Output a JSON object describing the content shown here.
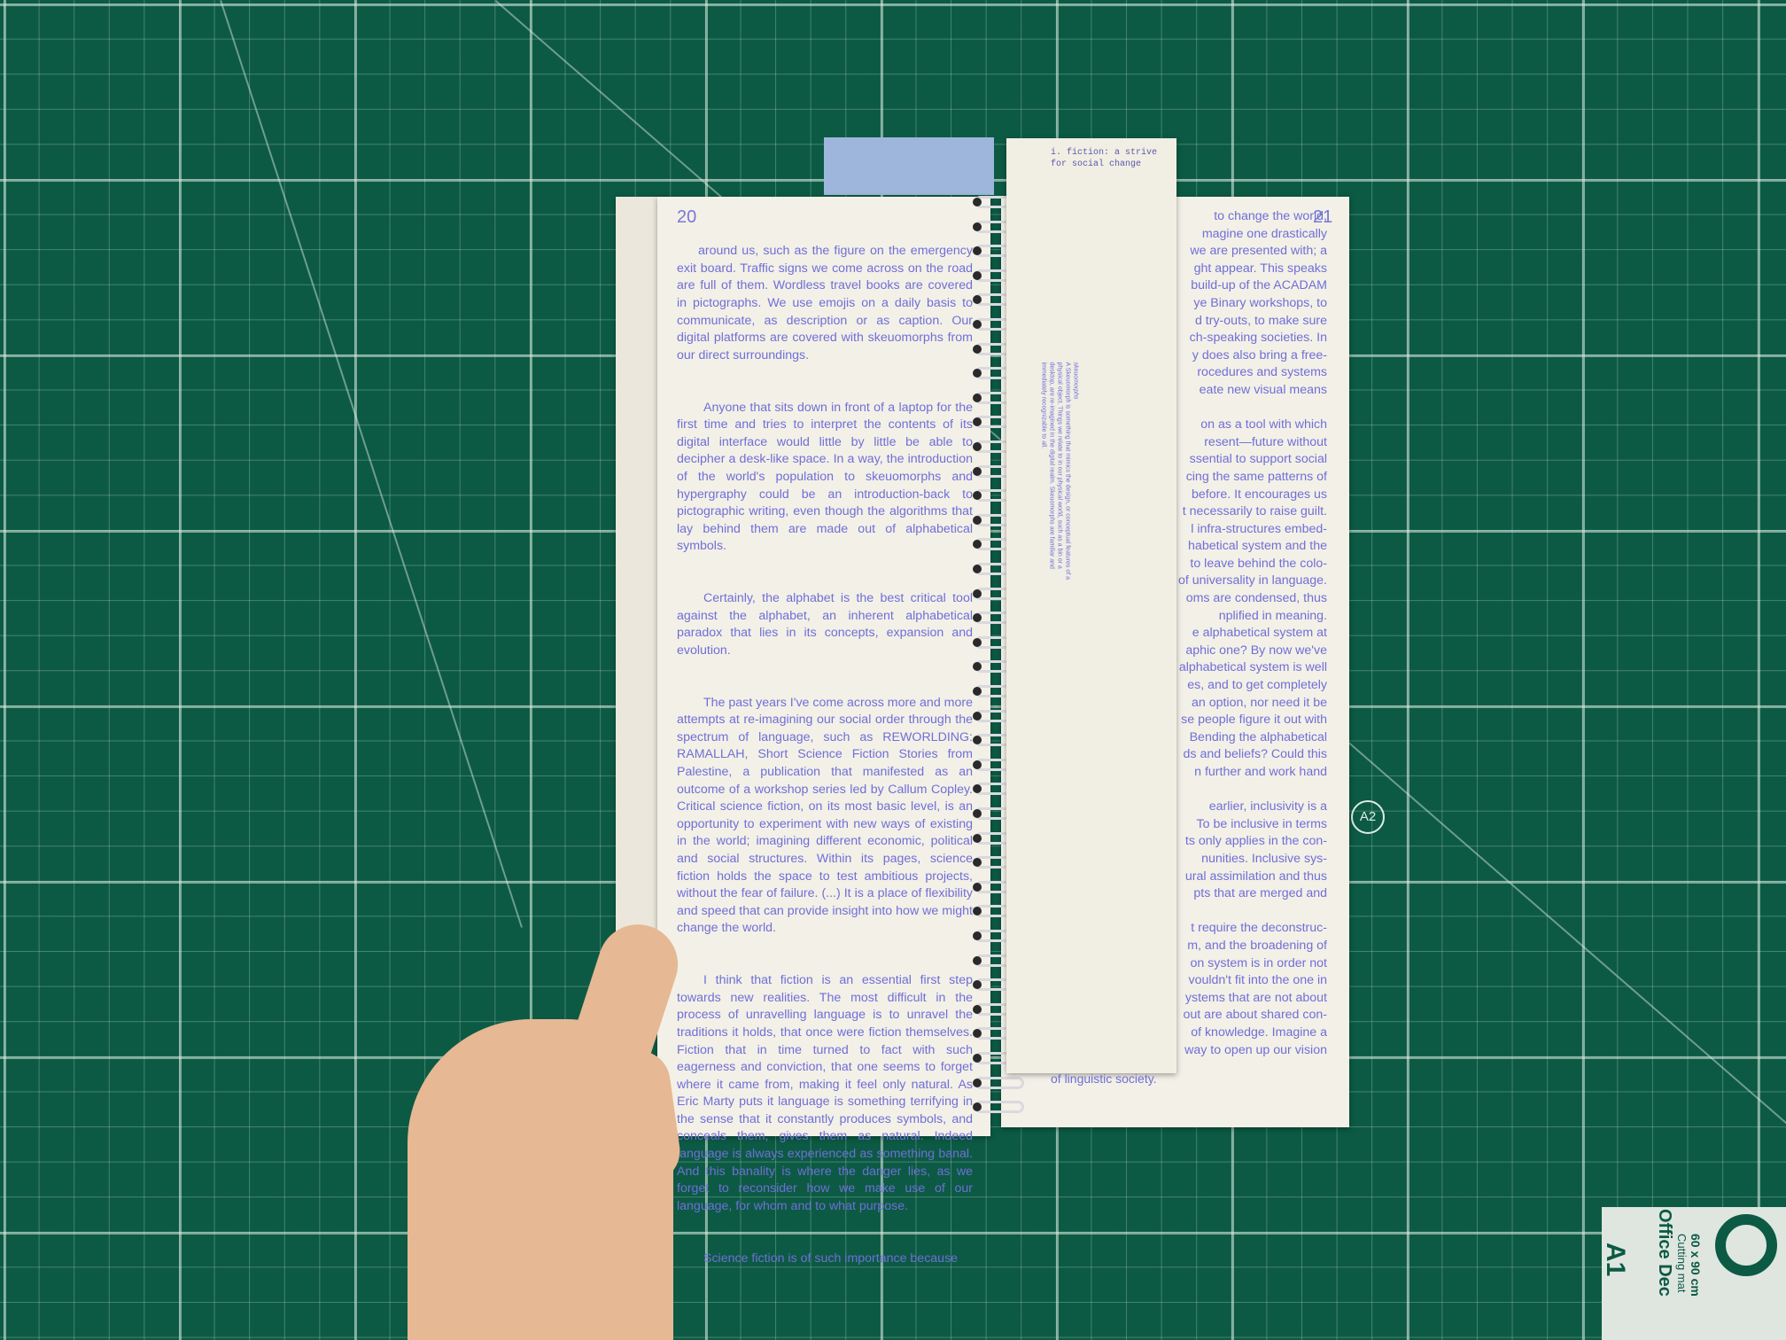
{
  "left_page": {
    "page_number": "20",
    "paragraphs": [
      "around us, such as the figure on the emergency exit board. Traffic signs we come across on the road are full of them. Wordless travel books are covered in pictographs. We use emojis on a daily basis to communicate, as description or as caption. Our digital platforms are covered with skeuomorphs from our direct surroundings.",
      "Anyone that sits down in front of a laptop for the first time and tries to interpret the contents of its digital interface would little by little be able to decipher a desk-like space. In a way, the introduction of the world's population to skeuomorphs and hypergraphy could be an introduction-back to pictographic writing, even though the algorithms that lay behind them are made out of alphabetical symbols.",
      "Certainly, the alphabet is the best critical tool against the alphabet, an inherent alphabetical paradox that lies in its concepts, expansion and evolution.",
      "The past years I've come across more and more attempts at re-imagining our social order through the spectrum of language, such as REWORLDING: RAMALLAH, Short Science Fiction Stories from Palestine, a publication that manifested as an outcome of a workshop series led by Callum Copley. Critical science fiction, on its most basic level, is an opportunity to experiment with new ways of existing in the world; imagining different economic, political and social structures. Within its pages, science fiction holds the space to test ambitious projects, without the fear of failure. (...) It is a place of flexibility and speed that can provide insight into how we might change the world.",
      "I think that fiction is an essential first step towards new realities. The most difficult in the process of unravelling language is to unravel the traditions it holds, that once were fiction themselves. Fiction that in time turned to fact with such eagerness and conviction, that one seems to forget where it came from, making it feel only natural. As Eric Marty puts it language is something terrifying in the sense that it constantly produces symbols, and conceals them, gives them as natural. Indeed language is always experienced as something banal. And this banality is where the danger lies, as we forget to reconsider how we make use of our language, for whom and to what purpose.",
      "Science fiction is of such importance because"
    ]
  },
  "right_page": {
    "page_number": "21",
    "paragraphs": [
      "to change the world,",
      "magine one drastically",
      "we are presented with; a",
      "ght appear. This speaks",
      "build-up of the ACADAM",
      "ye Binary workshops, to",
      "d try-outs, to make sure",
      "ch-speaking societies. In",
      "y does also bring a free-",
      "rocedures and systems",
      "eate new visual means",
      "",
      "on as a tool with which",
      "resent—future without",
      "ssential to support social",
      "cing the same patterns of",
      "before. It encourages us",
      "t necessarily to raise guilt.",
      "l infra-structures embed-",
      "habetical system and the",
      "to leave behind the colo-",
      "of universality in language.",
      "oms are condensed, thus",
      "nplified in meaning.",
      "e alphabetical system at",
      "aphic one? By now we've",
      "alphabetical system is well",
      "es, and to get completely",
      "an option, nor need it be",
      "se people figure it out with",
      "Bending the alphabetical",
      "ds and beliefs? Could this",
      "n further and work hand",
      "",
      "earlier, inclusivity is a",
      "To be inclusive in terms",
      "ts only applies in the con-",
      "nunities. Inclusive sys-",
      "ural assimilation and thus",
      "pts that are merged and",
      "",
      "t require the deconstruc-",
      "m, and the broadening of",
      "on system is in order not",
      "vouldn't fit into the one in",
      "ystems that are not about",
      "out are about shared con-",
      "of knowledge. Imagine a",
      "way to open up our vision"
    ]
  },
  "insert_strip": {
    "header": "i. fiction: a strive\nfor social change",
    "note_title": "skeuomorphs",
    "note_body": "A Skeuomorph is something that mimics the design, or conceptual features of a physical object. Things we relate to in our physical world, such as a bin or a desktop, are re-imagined in the digital realm. Skeuomorphs are familiar and immediately recognizable to all.",
    "footer": "of linguistic society."
  },
  "mat_labels": {
    "grid_marker": "A2",
    "corner_size": "A1",
    "brand": "Office Dec",
    "product": "Cutting mat",
    "dimensions": "60 x 90 cm"
  },
  "colors": {
    "mat_green": "#0c5a44",
    "paper": "#f3f0e7",
    "ink_purple": "#6f6fd8",
    "blue_tab": "#9fb6dc",
    "skin": "#e6b894"
  }
}
